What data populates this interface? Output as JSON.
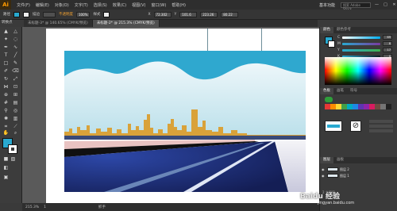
{
  "app": {
    "logo": "Ai"
  },
  "menu": [
    "文件(F)",
    "编辑(E)",
    "对象(O)",
    "文字(T)",
    "选择(S)",
    "效果(C)",
    "视图(V)",
    "窗口(W)",
    "帮助(H)"
  ],
  "workspace": "基本功能",
  "search_placeholder": "搜索 Adobe Stock",
  "window_controls": [
    "—",
    "□",
    "✕"
  ],
  "control_bar": {
    "selection_label": "路径",
    "stroke_label": "描边",
    "opacity_label": "不透明度",
    "opacity_value": "100%",
    "style_label": "样式",
    "x_label": "X",
    "x_value": "72.302",
    "y_label": "Y",
    "y_value": "101.6",
    "w_value": "223.26",
    "h_value": "80.22"
  },
  "tabs": [
    {
      "label": "未标题-3* @ 140.65% (CMYK/预览)",
      "active": false
    },
    {
      "label": "未标题-2* @ 215.3% (CMYK/预览)",
      "active": true
    }
  ],
  "toolbar_label": "转换点",
  "status": {
    "zoom": "215.3%",
    "artboard": "1",
    "tool": "抓手"
  },
  "panels": {
    "color_tabs": [
      "颜色",
      "颜色参考"
    ],
    "sliders": [
      {
        "letter": "C",
        "value": "69",
        "color": "#29a9d0"
      },
      {
        "letter": "M",
        "value": "8",
        "color": "#d04fa0"
      },
      {
        "letter": "Y",
        "value": "17",
        "color": "#e8d020"
      },
      {
        "letter": "K",
        "value": "0",
        "color": "#222222"
      }
    ],
    "swatch_tabs": [
      "色板",
      "画笔",
      "符号"
    ],
    "layers_tabs": [
      "图层",
      "画板"
    ],
    "layers": [
      "图层 2",
      "图层 1"
    ],
    "layers_count": "2 个图层"
  },
  "colors": {
    "sky": "#2fa8cf",
    "cloud": "#d8eef3",
    "city": "#d9a23a",
    "road": "#1b2a6b",
    "pink": "#e9c3c2",
    "white": "#ffffff"
  },
  "watermark": {
    "brand": "Baidu 经验",
    "url": "jingyan.baidu.com"
  }
}
